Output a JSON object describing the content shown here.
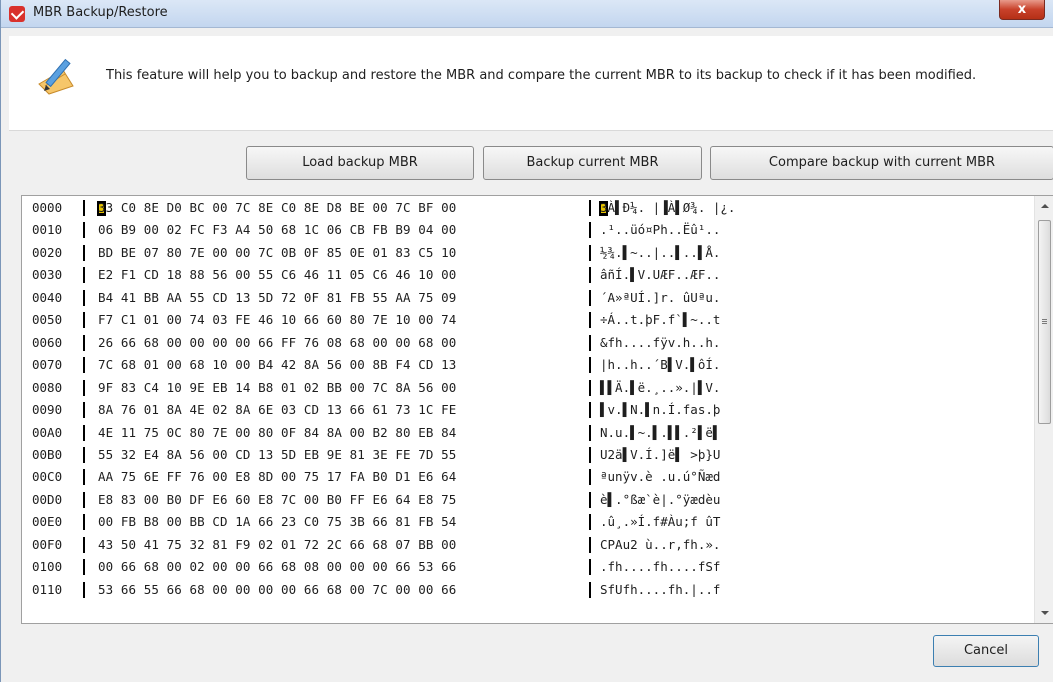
{
  "window": {
    "title": "MBR Backup/Restore",
    "close_label": "x"
  },
  "info": {
    "text": "This feature will help you to backup and restore the MBR and compare the current MBR to its backup to check if it has been modified."
  },
  "toolbar": {
    "load_label": "Load backup MBR",
    "backup_label": "Backup current MBR",
    "compare_label": "Compare backup with current MBR"
  },
  "footer": {
    "cancel_label": "Cancel"
  },
  "icons": {
    "feature": "pencil-ruler-icon",
    "app": "app-logo-icon",
    "close": "close-icon"
  },
  "hex_rows": [
    {
      "offset": "0000",
      "hex": "33 C0 8E D0 BC 00 7C 8E C0 8E D8 BE 00 7C BF 00",
      "ascii": "3À▌Ð¼. |▐À▌Ø¾. |¿."
    },
    {
      "offset": "0010",
      "hex": "06 B9 00 02 FC F3 A4 50 68 1C 06 CB FB B9 04 00",
      "ascii": ".¹..üó¤Ph..Ëû¹.."
    },
    {
      "offset": "0020",
      "hex": "BD BE 07 80 7E 00 00 7C 0B 0F 85 0E 01 83 C5 10",
      "ascii": "½¾.▌~..|..▌..▌Å."
    },
    {
      "offset": "0030",
      "hex": "E2 F1 CD 18 88 56 00 55 C6 46 11 05 C6 46 10 00",
      "ascii": "âñÍ.▌V.UÆF..ÆF.."
    },
    {
      "offset": "0040",
      "hex": "B4 41 BB AA 55 CD 13 5D 72 0F 81 FB 55 AA 75 09",
      "ascii": "´A»ªUÍ.]r. ûUªu."
    },
    {
      "offset": "0050",
      "hex": "F7 C1 01 00 74 03 FE 46 10 66 60 80 7E 10 00 74",
      "ascii": "÷Á..t.þF.f`▌~..t"
    },
    {
      "offset": "0060",
      "hex": "26 66 68 00 00 00 00 66 FF 76 08 68 00 00 68 00",
      "ascii": "&fh....fÿv.h..h."
    },
    {
      "offset": "0070",
      "hex": "7C 68 01 00 68 10 00 B4 42 8A 56 00 8B F4 CD 13",
      "ascii": "|h..h..´B▌V.▌ôÍ."
    },
    {
      "offset": "0080",
      "hex": "9F 83 C4 10 9E EB 14 B8 01 02 BB 00 7C 8A 56 00",
      "ascii": "▌▌Ä.▌ë.¸..».|▌V."
    },
    {
      "offset": "0090",
      "hex": "8A 76 01 8A 4E 02 8A 6E 03 CD 13 66 61 73 1C FE",
      "ascii": "▌v.▌N.▌n.Í.fas.þ"
    },
    {
      "offset": "00A0",
      "hex": "4E 11 75 0C 80 7E 00 80 0F 84 8A 00 B2 80 EB 84",
      "ascii": "N.u.▌~.▌.▌▌.²▌ë▌"
    },
    {
      "offset": "00B0",
      "hex": "55 32 E4 8A 56 00 CD 13 5D EB 9E 81 3E FE 7D 55",
      "ascii": "U2ä▌V.Í.]ë▌ >þ}U"
    },
    {
      "offset": "00C0",
      "hex": "AA 75 6E FF 76 00 E8 8D 00 75 17 FA B0 D1 E6 64",
      "ascii": "ªunÿv.è .u.ú°Ñæd"
    },
    {
      "offset": "00D0",
      "hex": "E8 83 00 B0 DF E6 60 E8 7C 00 B0 FF E6 64 E8 75",
      "ascii": "è▌.°ßæ`è|.°ÿædèu"
    },
    {
      "offset": "00E0",
      "hex": "00 FB B8 00 BB CD 1A 66 23 C0 75 3B 66 81 FB 54",
      "ascii": ".û¸.»Í.f#Àu;f ûT"
    },
    {
      "offset": "00F0",
      "hex": "43 50 41 75 32 81 F9 02 01 72 2C 66 68 07 BB 00",
      "ascii": "CPAu2 ù..r,fh.»."
    },
    {
      "offset": "0100",
      "hex": "00 66 68 00 02 00 00 66 68 08 00 00 00 66 53 66",
      "ascii": ".fh....fh....fSf"
    },
    {
      "offset": "0110",
      "hex": "53 66 55 66 68 00 00 00 00 66 68 00 7C 00 00 66",
      "ascii": "SfUfh....fh.|..f"
    }
  ]
}
